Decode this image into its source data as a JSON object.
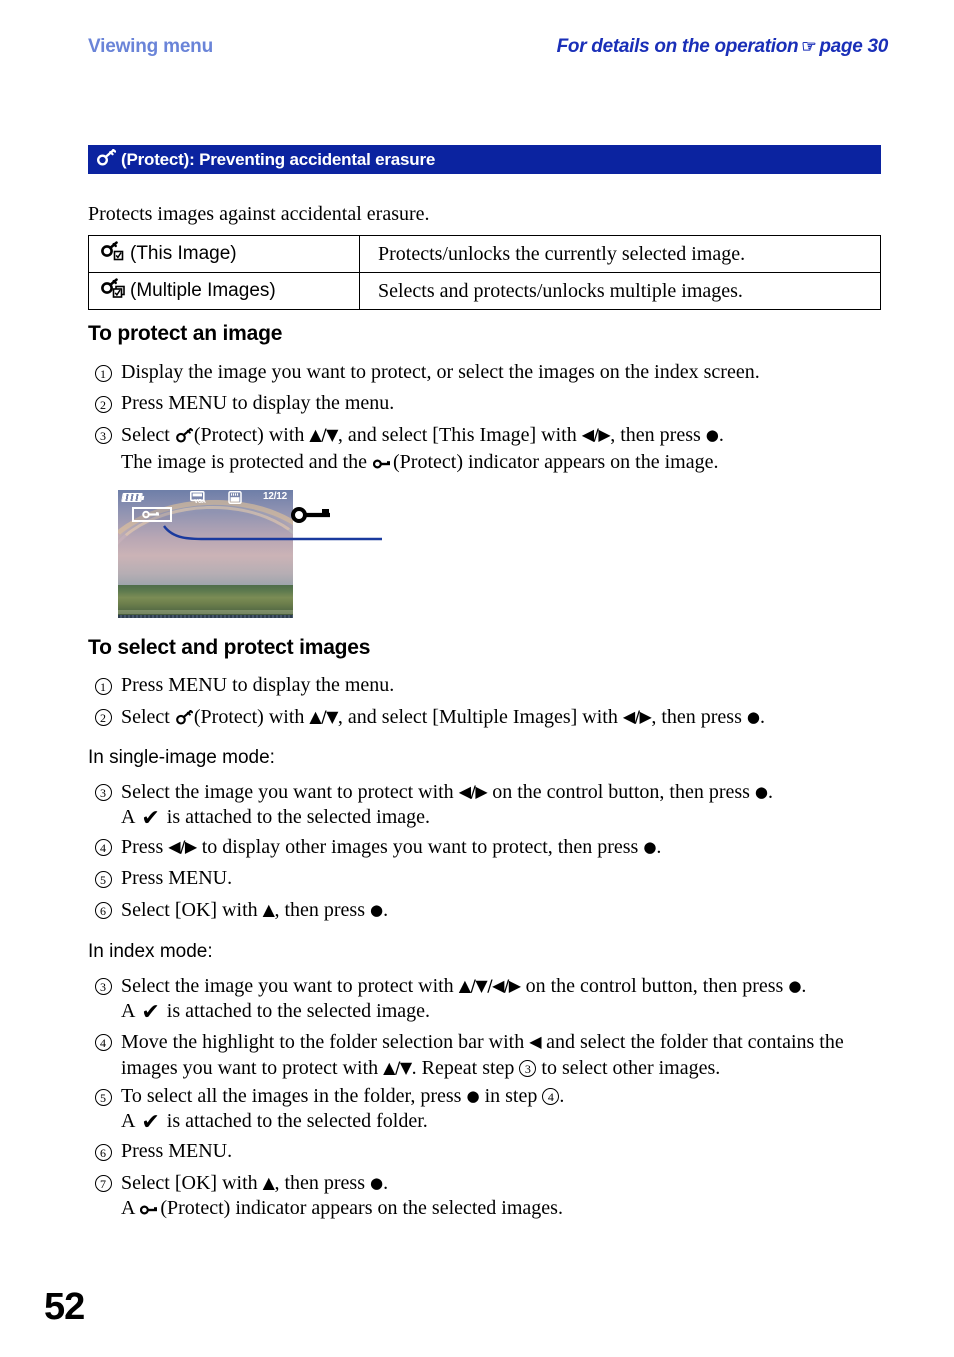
{
  "runhead": {
    "left": "Viewing menu",
    "right_before": "For details on the operation",
    "hand_icon": "☞",
    "right_after": "page 30"
  },
  "section": {
    "icon": "key-protect-icon",
    "title": "(Protect): Preventing accidental erasure"
  },
  "intro": "Protects images against accidental erasure.",
  "options_table": {
    "rows": [
      {
        "icon": "key-single-check-icon",
        "label": "(This Image)",
        "description": "Protects/unlocks the currently selected image."
      },
      {
        "icon": "key-multi-check-icon",
        "label": "(Multiple Images)",
        "description": "Selects and protects/unlocks multiple images."
      }
    ]
  },
  "section_protect_an_image": {
    "heading": "To protect an image",
    "steps": [
      {
        "num": "1",
        "text": "Display the image you want to protect, or select the images on the index screen."
      },
      {
        "num": "2",
        "text": "Press MENU to display the menu."
      },
      {
        "num": "3",
        "line1_a": "Select",
        "line1_b": "(Protect) with",
        "line1_updown": "▲/▼",
        "line1_c": ", and select [This Image] with",
        "line1_leftright": "◀/▶",
        "line1_d": ", then press",
        "line1_dot": "●",
        "line1_e": ".",
        "line2_a": "The image is protected and the",
        "line2_b": "(Protect) indicator appears on the image."
      }
    ]
  },
  "illustration": {
    "name": "camera-lcd-screen",
    "battery_icon": "battery-icon",
    "vga_icon": "vga-image-size-icon",
    "memory_card_icon": "memory-card-icon",
    "counter": "12/12",
    "badge_icon": "protect-key-indicator",
    "callout_icon": "protect-key-indicator"
  },
  "section_select_protect": {
    "heading": "To select and protect images",
    "steps": [
      {
        "num": "1",
        "text": "Press MENU to display the menu."
      },
      {
        "num": "2",
        "line1_a": "Select",
        "line1_b": "(Protect) with",
        "line1_updown": "▲/▼",
        "line1_c": ", and select [Multiple Images] with",
        "line1_leftright": "◀/▶",
        "line1_d": ", then press",
        "line1_dot": "●",
        "line1_e": "."
      }
    ],
    "single_mode_heading": "In single-image mode:",
    "single_mode_steps": [
      {
        "num": "3",
        "line1_a": "Select the image you want to protect with",
        "line1_leftright": "◀/▶",
        "line1_b": "on the control button, then press",
        "line1_dot": "●",
        "line1_c": ".",
        "line2_a": "A",
        "line2_check": "✔",
        "line2_b": "is attached to the selected image."
      },
      {
        "num": "4",
        "line1_a": "Press",
        "line1_leftright": "◀/▶",
        "line1_b": "to display other images you want to protect, then press",
        "line1_dot": "●",
        "line1_c": "."
      },
      {
        "num": "5",
        "text": "Press MENU."
      },
      {
        "num": "6",
        "line1_a": "Select [OK] with",
        "line1_up": "▲",
        "line1_b": ", then press",
        "line1_dot": "●",
        "line1_c": "."
      }
    ],
    "index_mode_heading": "In index mode:",
    "index_mode_steps": [
      {
        "num": "3",
        "line1_a": "Select the image you want to protect with",
        "line1_arrows": "▲/▼/◀/▶",
        "line1_b": "on the control button, then press",
        "line1_dot": "●",
        "line1_c": ".",
        "line2_a": "A",
        "line2_check": "✔",
        "line2_b": "is attached to the selected image."
      },
      {
        "num": "4",
        "line1_a": "Move the highlight to the folder selection bar with",
        "line1_left": "◀",
        "line1_b": "and select the folder that contains the",
        "line2_a": "images you want to protect with",
        "line2_updown": "▲/▼",
        "line2_b": ". Repeat step",
        "line2_stepnum": "3",
        "line2_c": "to select other images."
      },
      {
        "num": "5",
        "line1_a": "To select all the images in the folder, press",
        "line1_dot": "●",
        "line1_b": "in step",
        "line1_stepnum": "4",
        "line1_c": ".",
        "line2_a": "A",
        "line2_check": "✔",
        "line2_b": "is attached to the selected folder."
      },
      {
        "num": "6",
        "text": "Press MENU."
      },
      {
        "num": "7",
        "line1_a": "Select [OK] with",
        "line1_up": "▲",
        "line1_b": ", then press",
        "line1_dot": "●",
        "line1_c": ".",
        "line2_a": "A",
        "line2_b": "(Protect) indicator appears on the selected images."
      }
    ]
  },
  "folio": "52",
  "colors": {
    "section_bar_bg": "#0b23a0",
    "runhead_left": "#6a84d8",
    "runhead_right": "#1a2fb8",
    "callout_line": "#1a3a9e"
  }
}
